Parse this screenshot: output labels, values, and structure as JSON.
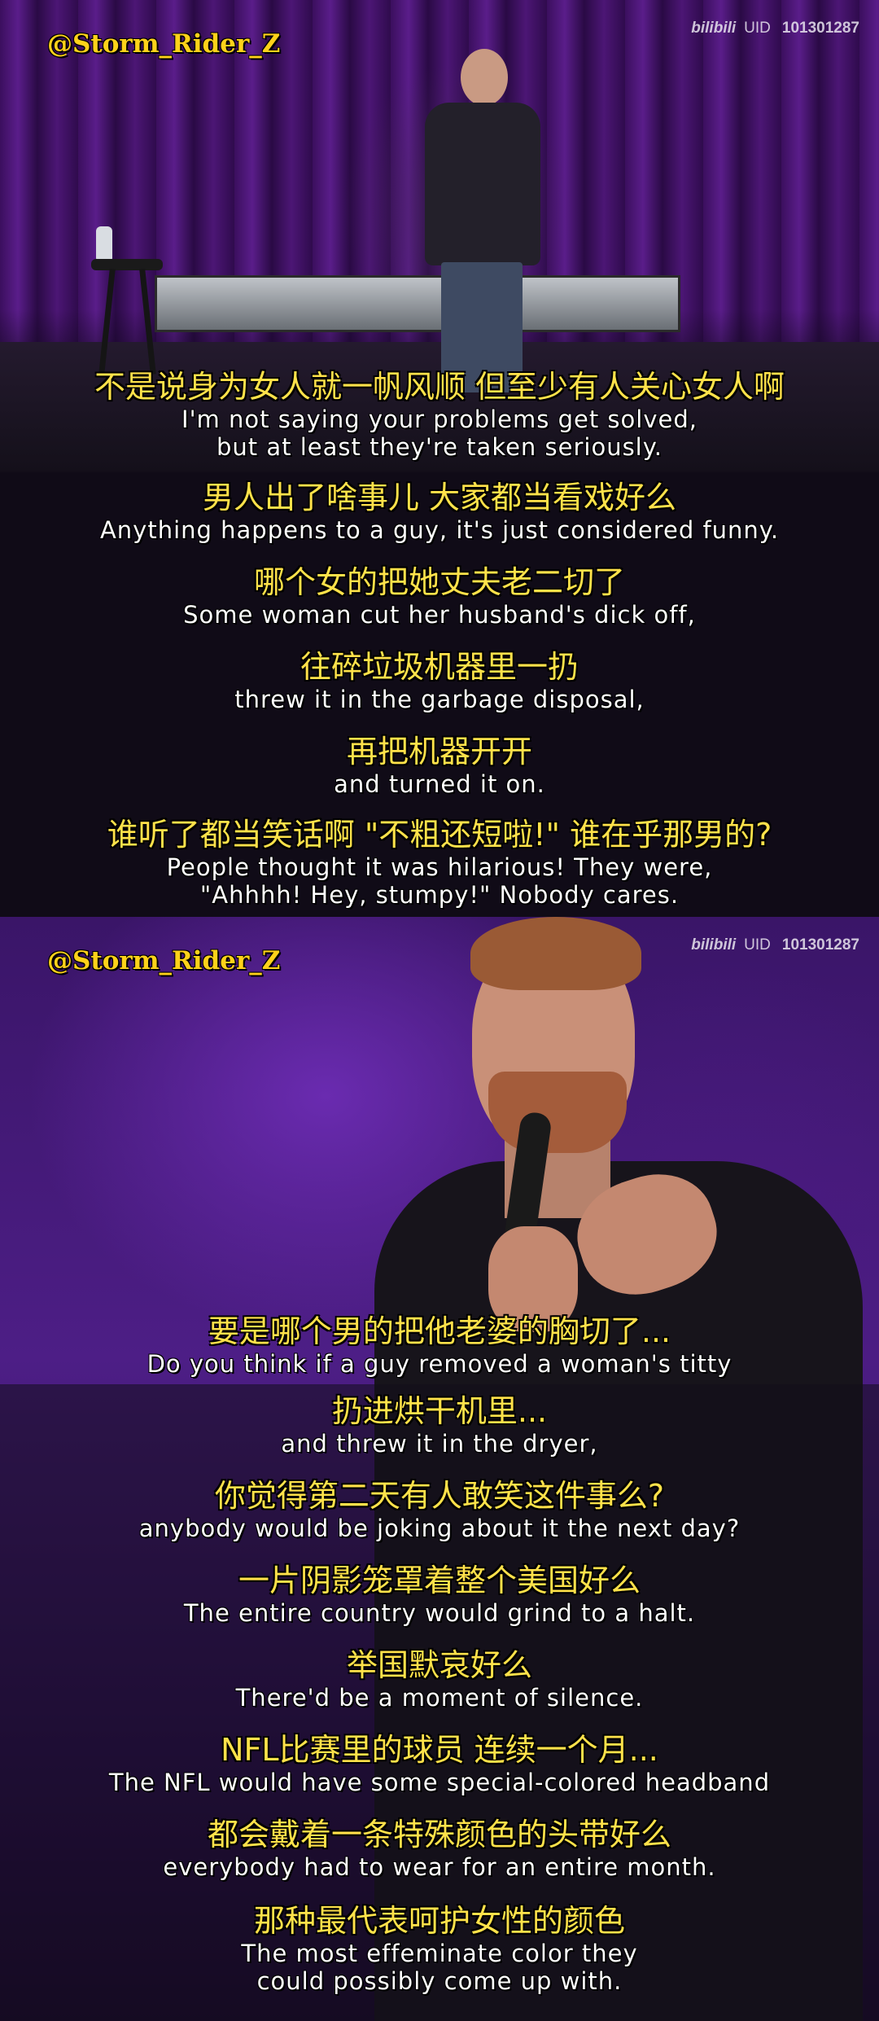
{
  "watermark": "@Storm_Rider_Z",
  "uid_mark": {
    "logo": "bilibili",
    "label": "UID",
    "number": "101301287"
  },
  "panel1_subtitles": [
    {
      "zh": "不是说身为女人就一帆风顺 但至少有人关心女人啊",
      "en": [
        "I'm not saying your problems get solved,",
        "but at least they're taken seriously."
      ]
    },
    {
      "zh": "男人出了啥事儿 大家都当看戏好么",
      "en": [
        "Anything happens to a guy, it's just considered funny."
      ]
    },
    {
      "zh": "哪个女的把她丈夫老二切了",
      "en": [
        "Some woman cut her husband's dick off,"
      ]
    },
    {
      "zh": "往碎垃圾机器里一扔",
      "en": [
        "threw it in the garbage disposal,"
      ]
    },
    {
      "zh": "再把机器开开",
      "en": [
        "and turned it on."
      ]
    },
    {
      "zh": "谁听了都当笑话啊 \"不粗还短啦!\" 谁在乎那男的?",
      "en": [
        "People thought it was hilarious! They were,",
        "\"Ahhhh! Hey, stumpy!\" Nobody cares."
      ]
    }
  ],
  "panel2_subtitles": [
    {
      "zh": "要是哪个男的把他老婆的胸切了...",
      "en": [
        "Do you think if a guy removed a woman's titty"
      ]
    },
    {
      "zh": "扔进烘干机里...",
      "en": [
        "and threw it in the dryer,"
      ]
    },
    {
      "zh": "你觉得第二天有人敢笑这件事么?",
      "en": [
        "anybody would be joking about it the next day?"
      ]
    },
    {
      "zh": "一片阴影笼罩着整个美国好么",
      "en": [
        "The entire country would grind to a halt."
      ]
    },
    {
      "zh": "举国默哀好么",
      "en": [
        "There'd be a moment of silence."
      ]
    },
    {
      "zh": "NFL比赛里的球员 连续一个月...",
      "en": [
        "The NFL would have some special-colored headband"
      ]
    },
    {
      "zh": "都会戴着一条特殊颜色的头带好么",
      "en": [
        "everybody had to wear for an entire month."
      ]
    },
    {
      "zh": "那种最代表呵护女性的颜色",
      "en": [
        "The most effeminate color they",
        "could possibly come up with."
      ]
    }
  ]
}
